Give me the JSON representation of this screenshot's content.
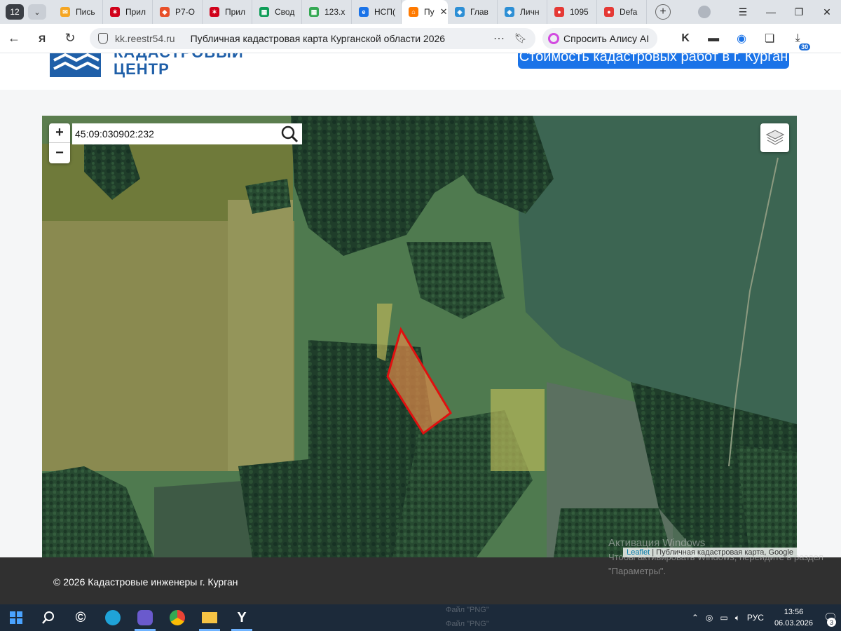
{
  "browser": {
    "tab_count": "12",
    "tabs": [
      {
        "label": "Пись",
        "color": "#f5a623",
        "glyph": "✉"
      },
      {
        "label": "Прил",
        "color": "#d0021b",
        "glyph": "✶"
      },
      {
        "label": "Р7-О",
        "color": "#e8502a",
        "glyph": "◆"
      },
      {
        "label": "Прил",
        "color": "#d0021b",
        "glyph": "✶"
      },
      {
        "label": "Свод",
        "color": "#0f9d58",
        "glyph": "▦"
      },
      {
        "label": "123.x",
        "color": "#34a853",
        "glyph": "▦"
      },
      {
        "label": "НСП(",
        "color": "#1a73e8",
        "glyph": "e"
      },
      {
        "label": "Пу",
        "color": "#ff7a00",
        "glyph": "⌂"
      },
      {
        "label": "Глав",
        "color": "#2d8fd5",
        "glyph": "◈"
      },
      {
        "label": "Личн",
        "color": "#2d8fd5",
        "glyph": "◈"
      },
      {
        "label": "1095",
        "color": "#e53935",
        "glyph": "●"
      },
      {
        "label": "Defa",
        "color": "#e53935",
        "glyph": "●"
      }
    ],
    "active_tab_index": 7,
    "url_domain": "kk.reestr54.ru",
    "url_title": "Публичная кадастровая карта Курганской области 2026",
    "alice_label": "Спросить Алису AI",
    "ext_badge": "30"
  },
  "site": {
    "logo_line1": "КАДАСТРОВЫЙ",
    "logo_line2": "ЦЕНТР",
    "cta_label": "Стоимость кадастровых работ в г. Курган",
    "brand_color": "#1f5fa8",
    "accent_color": "#1a73e8"
  },
  "map": {
    "zoom_in": "+",
    "zoom_out": "−",
    "search_value": "45:09:030902:232",
    "attribution_link": "Leaflet",
    "attribution_text": " | Публичная кадастровая карта, Google",
    "parcel_stroke": "#e01010",
    "parcel_fill": "#e08a4a"
  },
  "footer": {
    "copyright": "© 2026 Кадастровые инженеры г. Курган",
    "watermark_title": "Активация Windows",
    "watermark_text": "Чтобы активировать Windows, перейдите в раздел \"Параметры\"."
  },
  "taskbar": {
    "bg_text_1": "Файл \"PNG\"",
    "bg_text_2": "Файл \"PNG\"",
    "lang": "РУС",
    "time": "13:56",
    "date": "06.03.2026",
    "notif_count": "3"
  }
}
